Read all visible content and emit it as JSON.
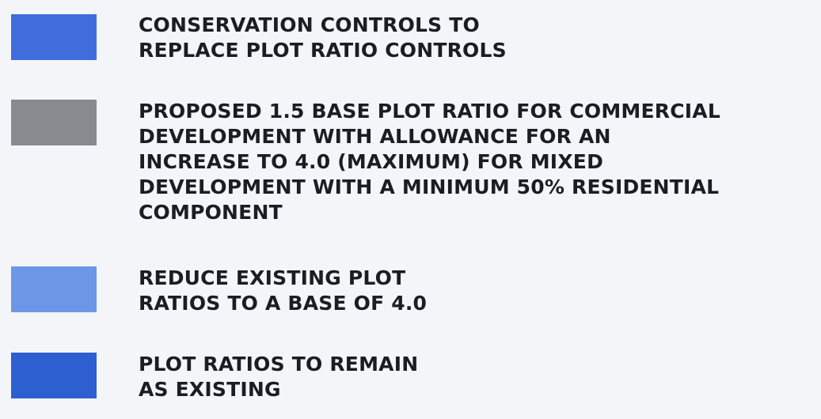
{
  "legend": {
    "items": [
      {
        "color": "#3f6edc",
        "label": "CONSERVATION CONTROLS TO\nREPLACE PLOT RATIO CONTROLS"
      },
      {
        "color": "#878b90",
        "label": "PROPOSED 1.5 BASE PLOT RATIO FOR COMMERCIAL\nDEVELOPMENT WITH ALLOWANCE FOR AN\nINCREASE TO 4.0 (MAXIMUM) FOR MIXED\nDEVELOPMENT WITH A MINIMUM 50% RESIDENTIAL\nCOMPONENT"
      },
      {
        "color": "#6d97e6",
        "label": "REDUCE EXISTING PLOT\nRATIOS TO A BASE OF 4.0"
      },
      {
        "color": "#2d5fd0",
        "label": "PLOT RATIOS TO REMAIN\nAS EXISTING"
      }
    ]
  }
}
